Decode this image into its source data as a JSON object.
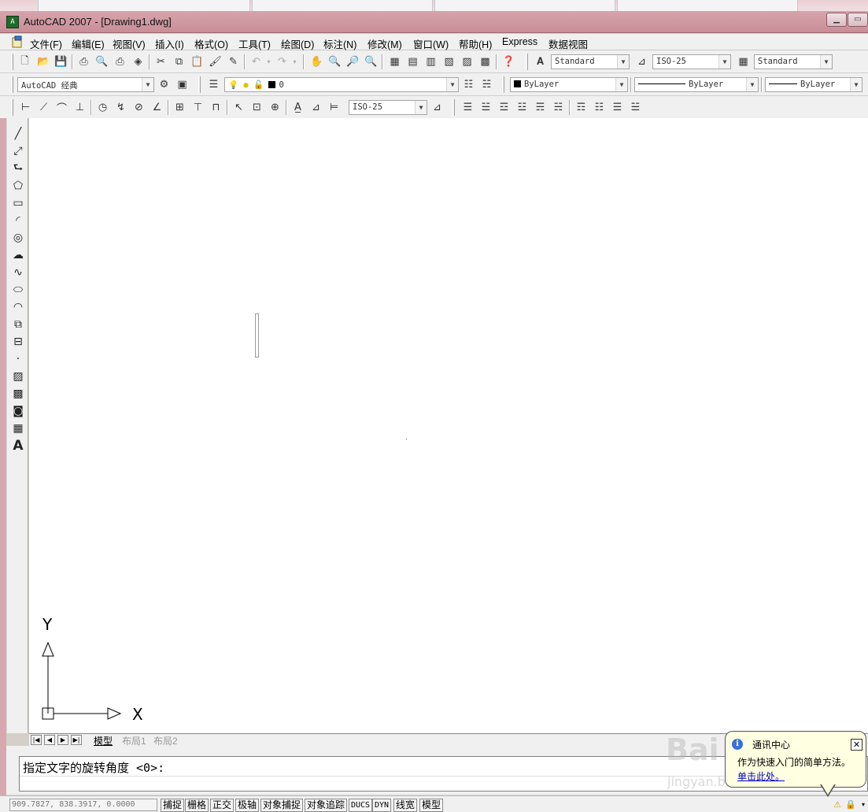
{
  "window": {
    "title": "AutoCAD 2007 - [Drawing1.dwg]"
  },
  "menu": {
    "items": [
      "文件(F)",
      "编辑(E)",
      "视图(V)",
      "插入(I)",
      "格式(O)",
      "工具(T)",
      "绘图(D)",
      "标注(N)",
      "修改(M)",
      "窗口(W)",
      "帮助(H)",
      "Express",
      "数据视图"
    ]
  },
  "toolbar_standard": {
    "text_style": "Standard",
    "dim_style": "ISO-25",
    "table_style": "Standard"
  },
  "toolbar_layers": {
    "workspace": "AutoCAD 经典",
    "current_layer": "0",
    "color": "ByLayer",
    "linetype": "ByLayer",
    "lineweight": "ByLayer"
  },
  "toolbar_dimension": {
    "dim_style": "ISO-25"
  },
  "layout_tabs": {
    "items": [
      "模型",
      "布局1",
      "布局2"
    ]
  },
  "command": {
    "prompt": "指定文字的旋转角度 <0>:"
  },
  "status_bar": {
    "coordinates": "909.7827,  838.3917, 0.0000",
    "toggles": [
      "捕捉",
      "栅格",
      "正交",
      "极轴",
      "对象捕捉",
      "对象追踪",
      "DUCS",
      "DYN",
      "线宽",
      "模型"
    ]
  },
  "notification": {
    "title": "通讯中心",
    "body": "作为快速入门的简单方法。",
    "link": "单击此处。"
  },
  "ucs": {
    "x_label": "X",
    "y_label": "Y"
  },
  "watermark": {
    "text": "Bai",
    "sub": "jingyan.baidu.com"
  },
  "colors": {
    "titlebar": "#c98e98",
    "canvas": "#ffffff",
    "balloon": "#ffffe1",
    "link": "#0000cc"
  }
}
